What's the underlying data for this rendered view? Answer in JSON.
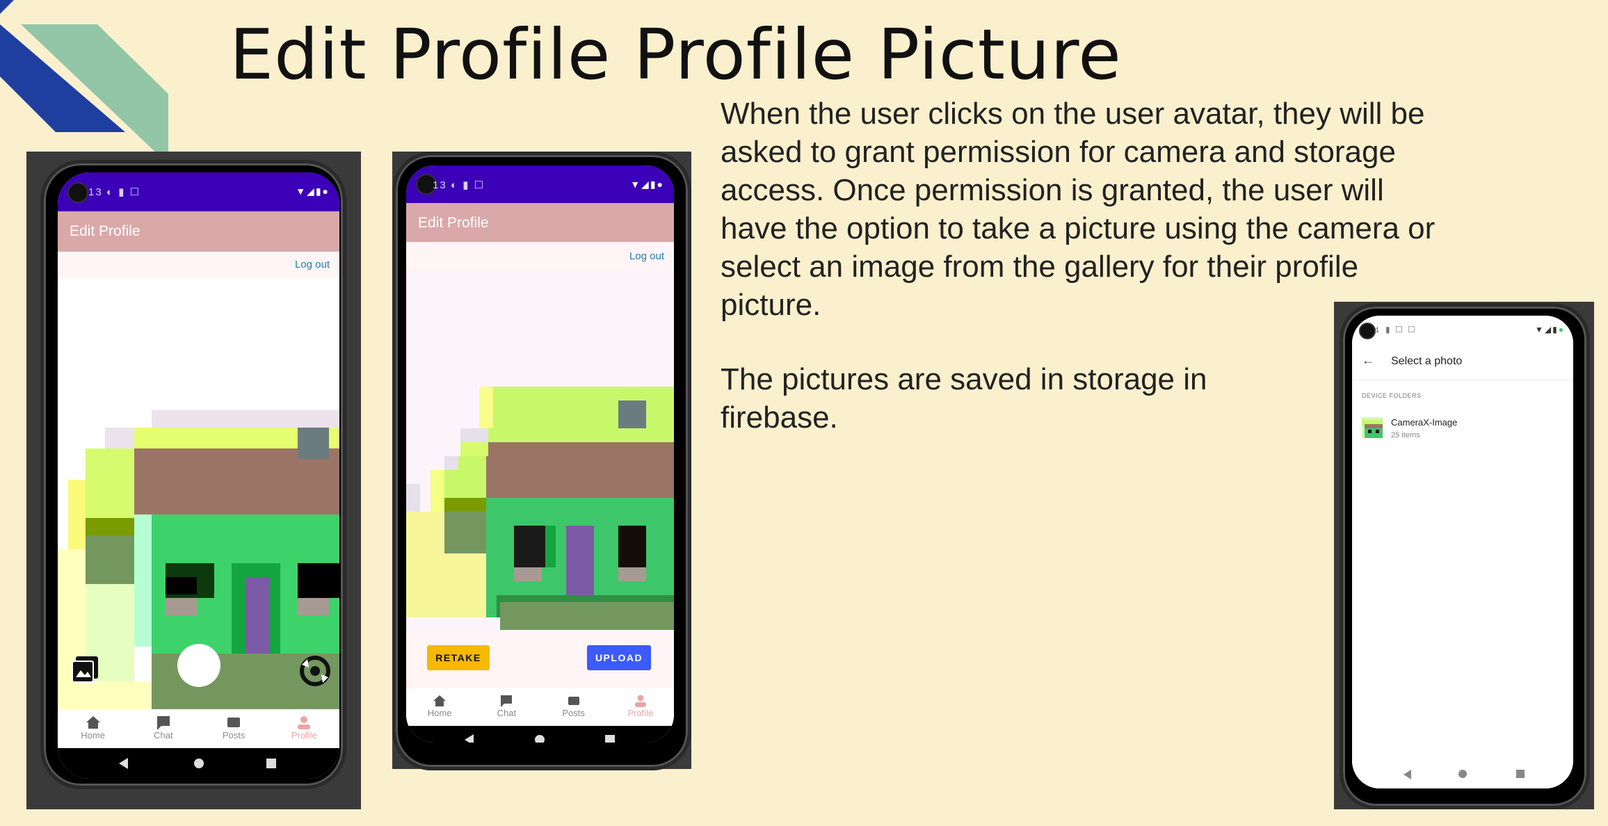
{
  "slide": {
    "title": "Edit Profile Profile Picture",
    "paragraph1": "When the user clicks on the user avatar, they will be asked to grant permission for camera and storage access. Once permission is granted, the user will have the option to take a picture using the camera or select an image from the gallery for their profile picture.",
    "paragraph2": "The pictures are saved in storage in firebase."
  },
  "phone1": {
    "status_time": "13",
    "appbar_title": "Edit Profile",
    "logout": "Log out",
    "nav": [
      "Home",
      "Chat",
      "Posts",
      "Profile"
    ],
    "active_nav": "Profile",
    "icons": [
      "gallery-icon",
      "shutter-button",
      "switch-camera-icon"
    ]
  },
  "phone2": {
    "status_time": "13",
    "appbar_title": "Edit Profile",
    "logout": "Log out",
    "retake_label": "RETAKE",
    "upload_label": "UPLOAD",
    "nav": [
      "Home",
      "Chat",
      "Posts",
      "Profile"
    ],
    "active_nav": "Profile"
  },
  "phone3": {
    "status_time": "4",
    "header_title": "Select a photo",
    "section_label": "DEVICE FOLDERS",
    "folder_name": "CameraX-Image",
    "folder_count": "25 items"
  },
  "colors": {
    "background": "#fbf0cd",
    "statusbar": "#3b00b7",
    "appbar": "#daa8a8",
    "accent_pink": "#e9a5a5",
    "retake": "#f5b900",
    "upload": "#3d5afe",
    "deco_blue": "#1e3fa0",
    "deco_green": "#92c6a7"
  }
}
